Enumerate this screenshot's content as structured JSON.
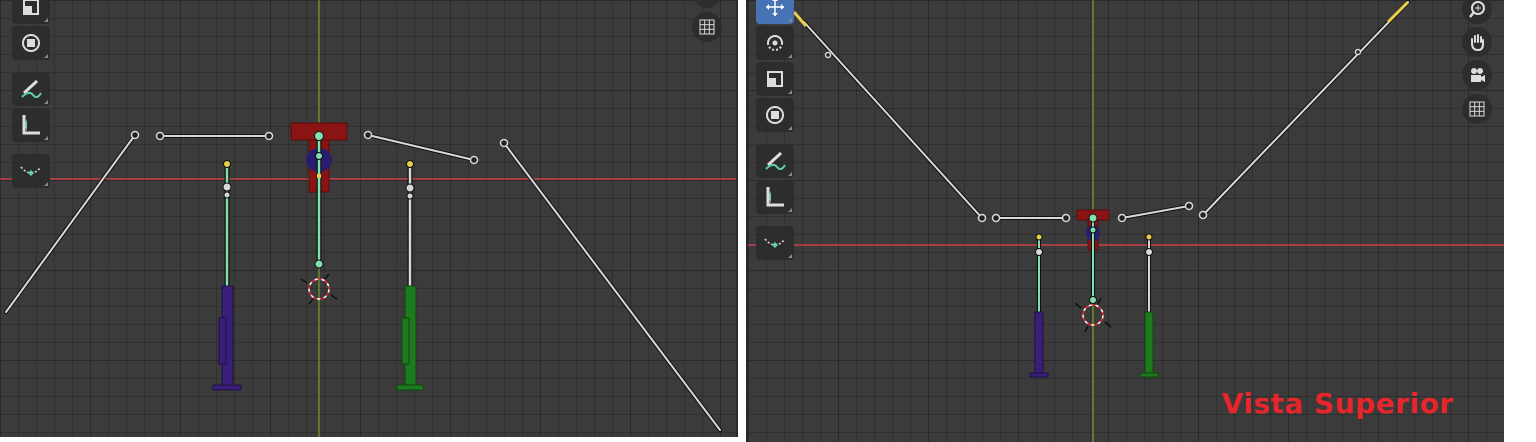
{
  "caption": "Vista Superior",
  "colors": {
    "viewport_bg": "#3b3b3b",
    "x_axis": "#c8414a",
    "y_axis": "#7c9c2a",
    "bone": "#d8d8d8",
    "bone_selected": "#7fe0b0",
    "bone_tip": "#e6cf4a",
    "red_shape": "#8a1414",
    "purple_shape": "#3a1f7a",
    "green_shape": "#1f7a1f",
    "active_tool": "#4772b3",
    "caption": "#e8252a"
  },
  "left_view": {
    "toolbar": [
      "scale-tool-icon",
      "transform-tool-icon",
      "annotate-tool-icon",
      "measure-tool-icon",
      "bend-tool-icon"
    ],
    "nav": [
      "grid-toggle-icon"
    ]
  },
  "right_view": {
    "toolbar": [
      "move-tool-icon",
      "rotate-tool-icon",
      "scale-tool-icon",
      "transform-tool-icon",
      "annotate-tool-icon",
      "measure-tool-icon",
      "bend-tool-icon"
    ],
    "nav": [
      "zoom-icon",
      "pan-hand-icon",
      "camera-icon",
      "grid-toggle-icon"
    ]
  }
}
